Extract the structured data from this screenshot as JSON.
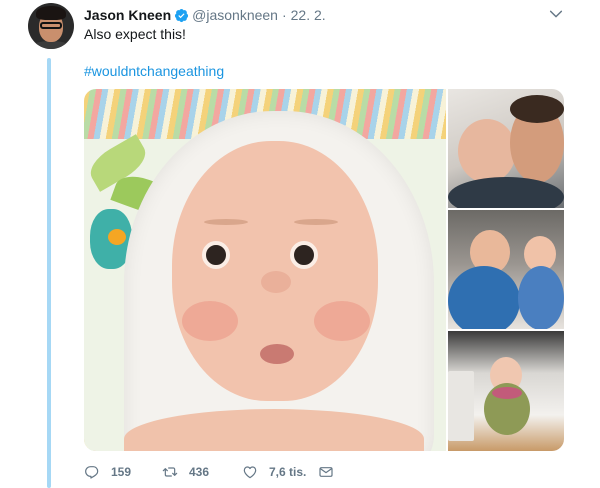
{
  "tweet": {
    "author_name": "Jason Kneen",
    "handle": "@jasonkneen",
    "separator": "·",
    "date": "22. 2.",
    "text": "Also expect this!",
    "hashtag": "#wouldntchangeathing",
    "verified": true
  },
  "actions": {
    "replies": "159",
    "retweets": "436",
    "likes": "7,6 tis."
  },
  "colors": {
    "link": "#1b95e0",
    "thread_line": "#a6d8f5",
    "secondary_text": "#657786"
  },
  "icons": {
    "verified": "verified-badge-icon",
    "caret": "chevron-down-icon",
    "reply": "reply-icon",
    "retweet": "retweet-icon",
    "like": "heart-icon",
    "dm": "envelope-icon"
  }
}
